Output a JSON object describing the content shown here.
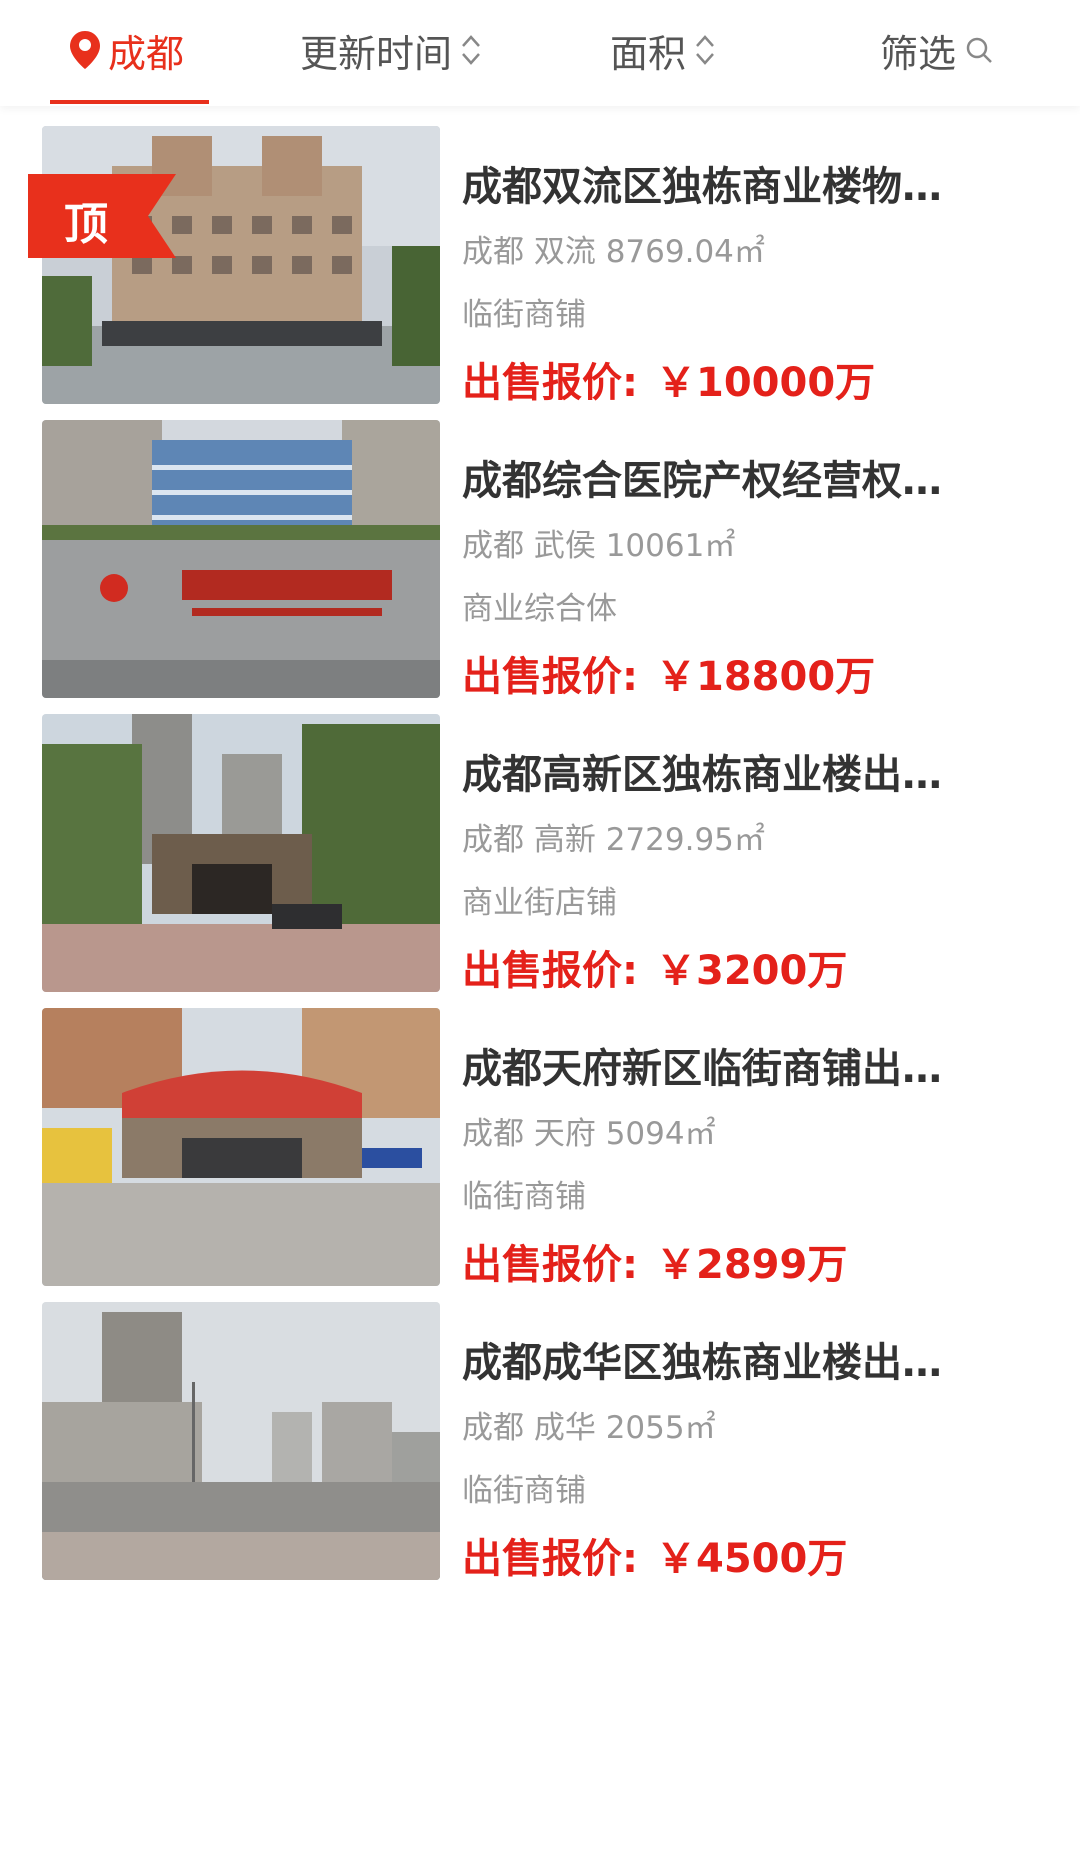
{
  "header": {
    "city_label": "成都",
    "sort_time_label": "更新时间",
    "sort_area_label": "面积",
    "filter_label": "筛选"
  },
  "colors": {
    "accent": "#e8301c",
    "price": "#e4211a",
    "meta": "#999999"
  },
  "listings": [
    {
      "title": "成都双流区独栋商业楼物…",
      "meta": "成都 双流 8769.04㎡",
      "type": "临街商铺",
      "price_label": "出售报价:",
      "price_value": "￥10000万",
      "badge": "顶",
      "image_icon": "building-photo"
    },
    {
      "title": "成都综合医院产权经营权…",
      "meta": "成都 武侯 10061㎡",
      "type": "商业综合体",
      "price_label": "出售报价:",
      "price_value": "￥18800万",
      "image_icon": "hospital-photo"
    },
    {
      "title": "成都高新区独栋商业楼出…",
      "meta": "成都 高新 2729.95㎡",
      "type": "商业街店铺",
      "price_label": "出售报价:",
      "price_value": "￥3200万",
      "image_icon": "building-photo"
    },
    {
      "title": "成都天府新区临街商铺出…",
      "meta": "成都 天府 5094㎡",
      "type": "临街商铺",
      "price_label": "出售报价:",
      "price_value": "￥2899万",
      "image_icon": "shop-photo"
    },
    {
      "title": "成都成华区独栋商业楼出…",
      "meta": "成都 成华 2055㎡",
      "type": "临街商铺",
      "price_label": "出售报价:",
      "price_value": "￥4500万",
      "image_icon": "street-photo"
    }
  ]
}
